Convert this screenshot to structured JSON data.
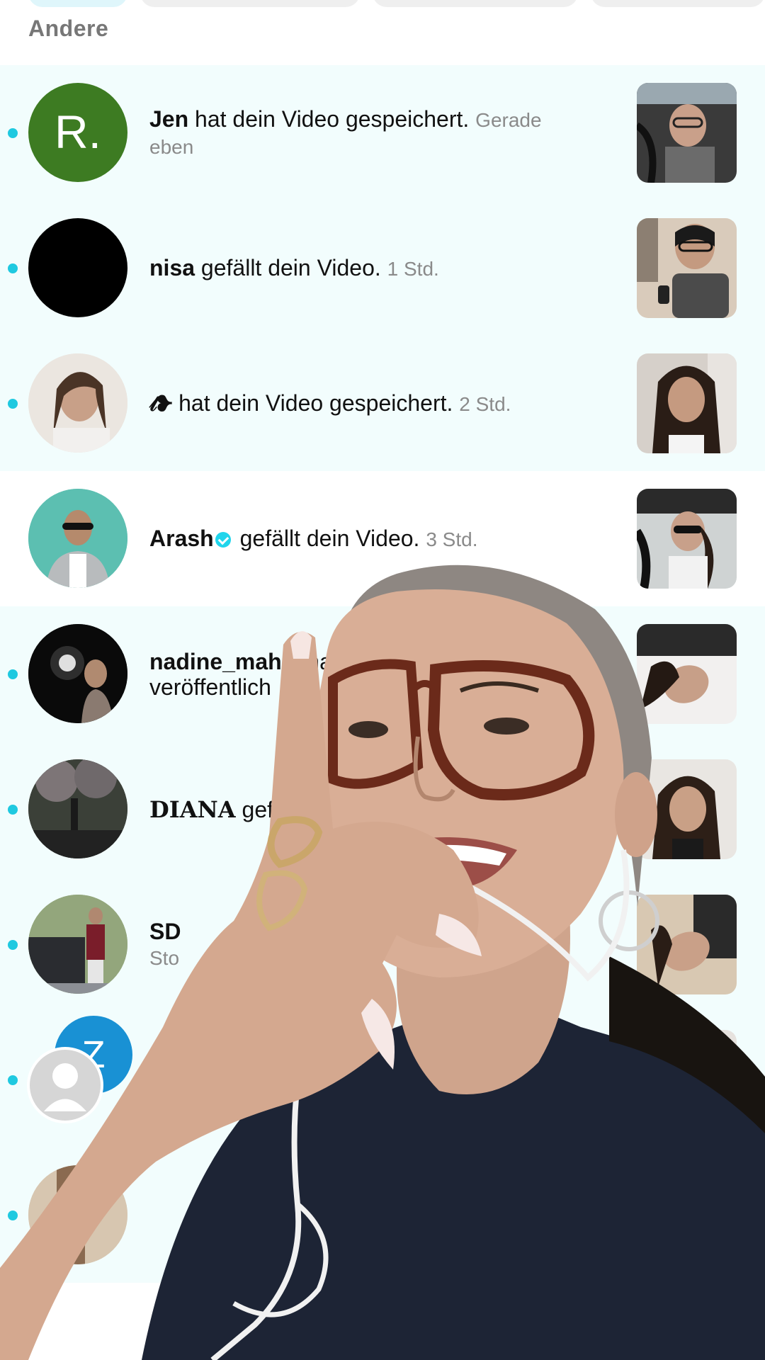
{
  "section_title": "Andere",
  "notifications": [
    {
      "avatar_letter": "R.",
      "username": "Jen",
      "action": "hat dein Video gespeichert.",
      "time": "Gerade eben",
      "unread": true
    },
    {
      "avatar_letter": "",
      "username": "nisa",
      "action": "gefällt dein Video.",
      "time": "1 Std.",
      "unread": true
    },
    {
      "avatar_letter": "",
      "username": "𝓉❥",
      "action": "hat dein Video gespeichert.",
      "time": "2 Std.",
      "unread": true
    },
    {
      "avatar_letter": "",
      "username": "Arash",
      "action": "gefällt dein Video.",
      "time": "3 Std.",
      "unread": false,
      "verified": true
    },
    {
      "avatar_letter": "",
      "username": "nadine_mah",
      "action": "b ha",
      "line2": "veröffentlich",
      "unread": true
    },
    {
      "avatar_letter": "",
      "username": "DIANA",
      "action": "gef",
      "unread": true
    },
    {
      "avatar_letter": "",
      "username": "SD",
      "line2": "Sto",
      "unread": true
    },
    {
      "avatar_letter": "Z",
      "username": "",
      "unread": true
    },
    {
      "avatar_letter": "",
      "username": "",
      "unread": true
    }
  ],
  "colors": {
    "unread_bg": "#f2fdfd",
    "unread_dot": "#1fc9e0",
    "verified": "#20d5ec",
    "avatar_green": "#3d7b22",
    "avatar_blue": "#1991d4"
  }
}
